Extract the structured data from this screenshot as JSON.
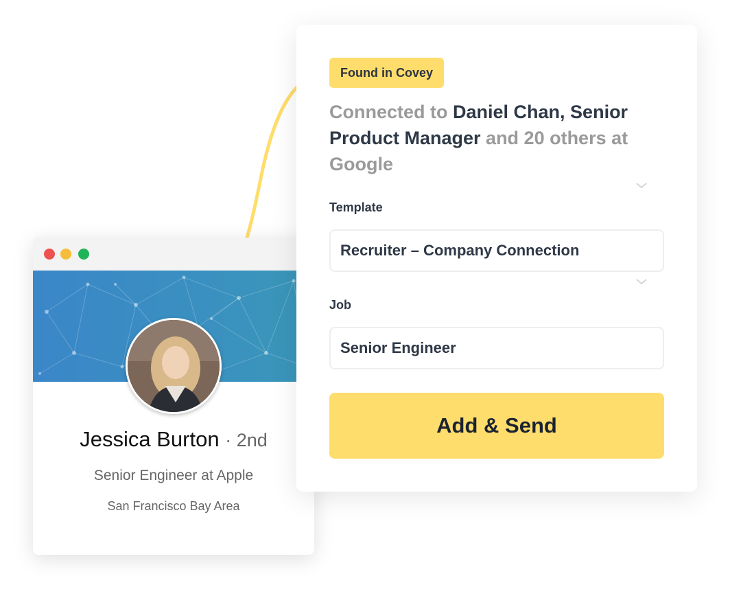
{
  "profile": {
    "name": "Jessica Burton",
    "degree": "· 2nd",
    "headline": "Senior Engineer at Apple",
    "location": "San Francisco Bay Area",
    "window_controls": [
      "close",
      "minimize",
      "maximize"
    ],
    "colors": {
      "banner": "#3b8ac4",
      "close": "#ee5250",
      "minimize": "#f5bd39",
      "maximize": "#21b358"
    }
  },
  "covey": {
    "badge": "Found in Covey",
    "connected_prefix": "Connected to ",
    "connected_name": "Daniel Chan,",
    "connected_role": "Senior Product Manager",
    "connected_suffix": " and 20 others at Google",
    "template_label": "Template",
    "template_value": "Recruiter – Company Connection",
    "job_label": "Job",
    "job_value": "Senior Engineer",
    "send_button": "Add & Send",
    "icons": [
      "chevron-down-icon",
      "chevron-down-icon"
    ],
    "colors": {
      "accent": "#ffdd6c",
      "text": "#2e3846",
      "muted": "#9a9a9a"
    }
  }
}
